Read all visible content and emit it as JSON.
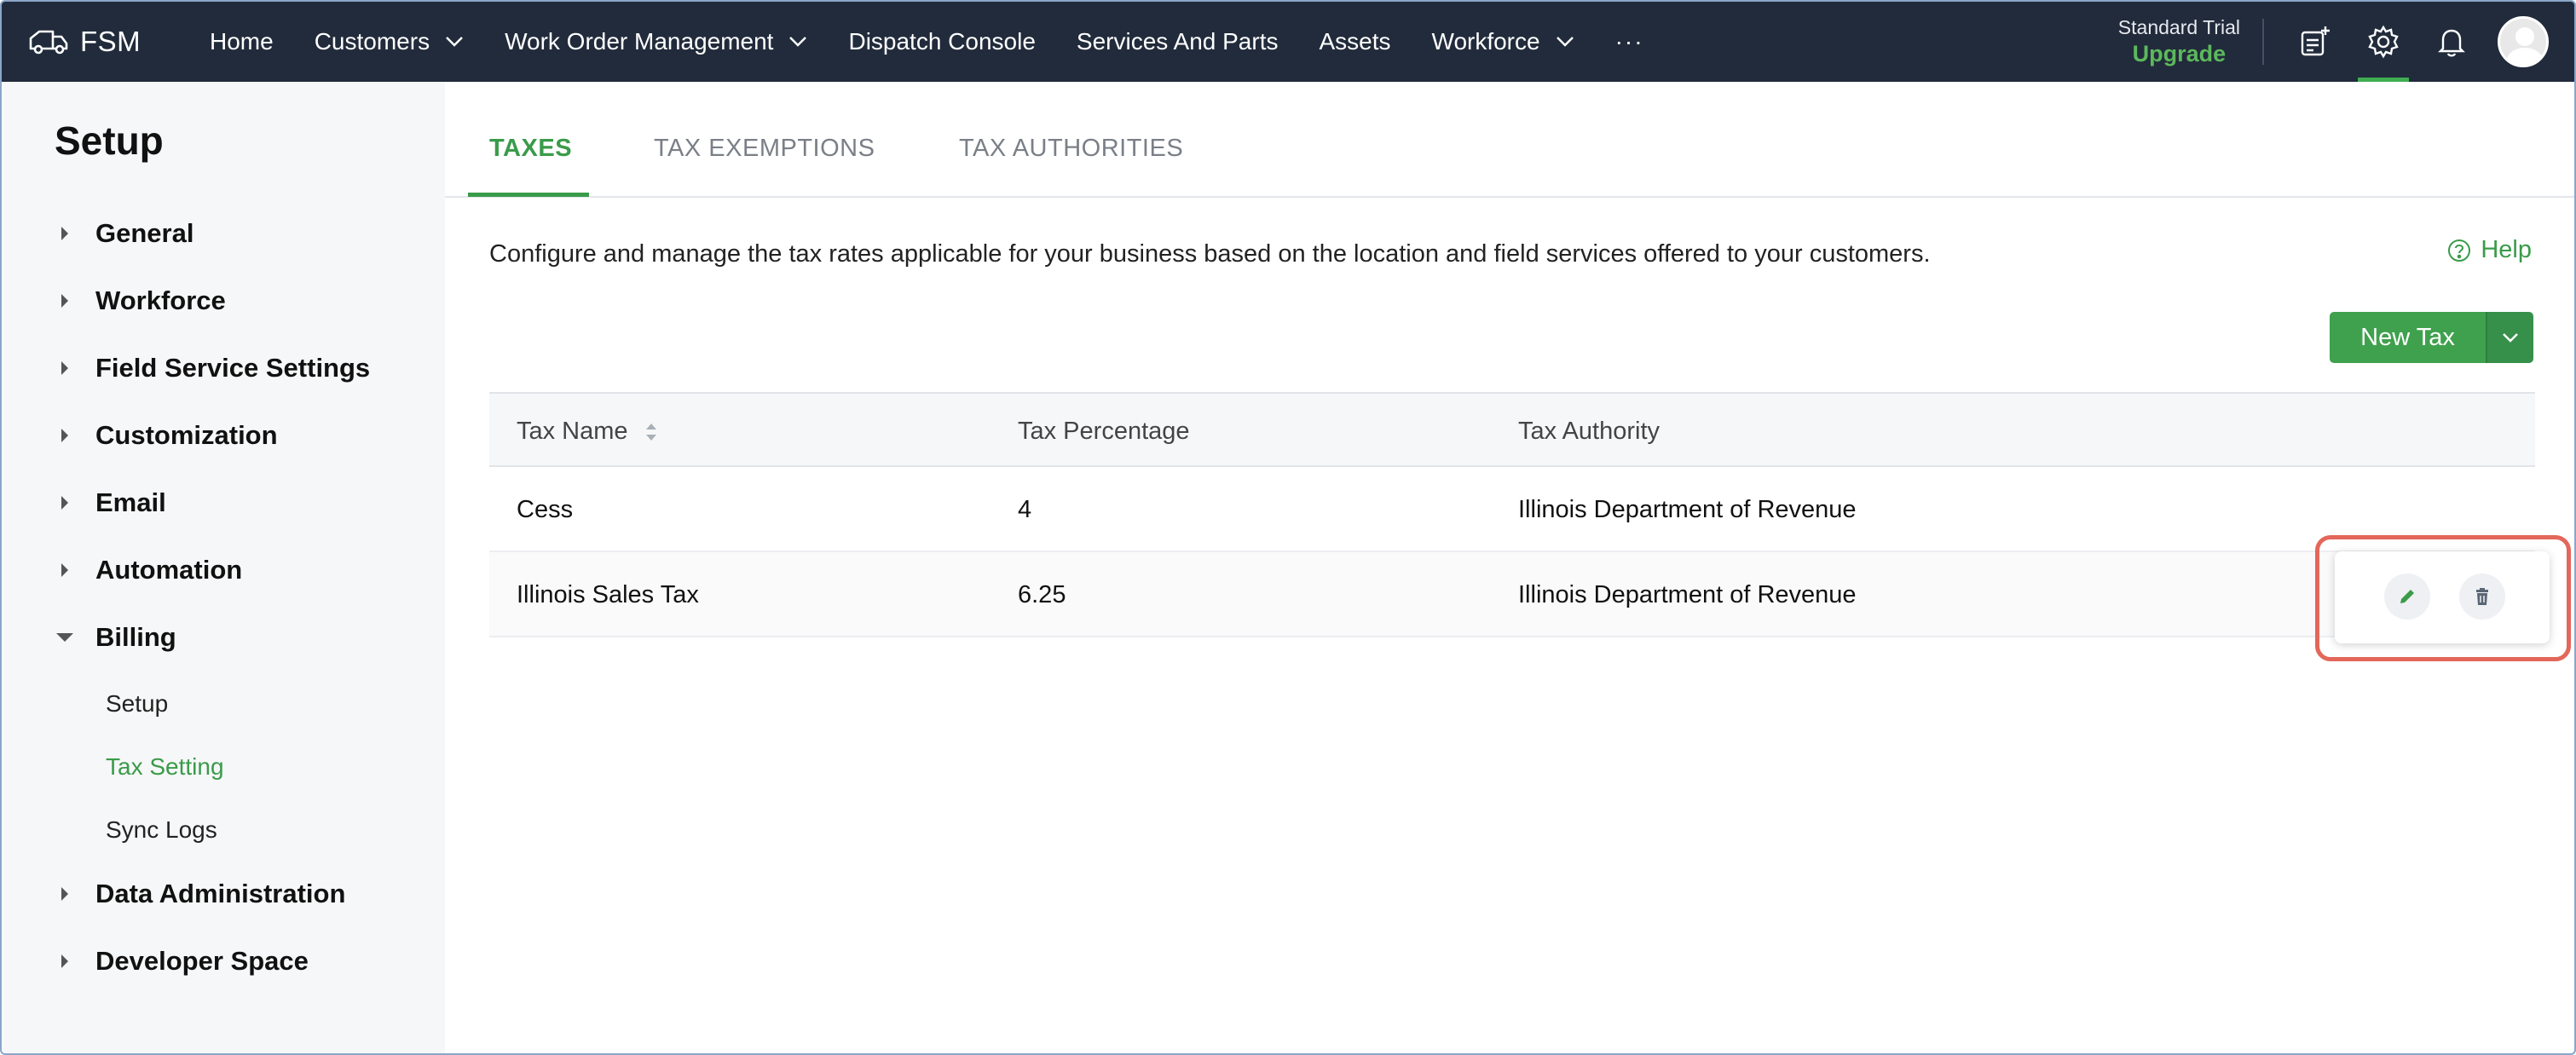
{
  "app": {
    "brand": "FSM"
  },
  "nav": {
    "items": [
      {
        "label": "Home"
      },
      {
        "label": "Customers"
      },
      {
        "label": "Work Order Management"
      },
      {
        "label": "Dispatch Console"
      },
      {
        "label": "Services And Parts"
      },
      {
        "label": "Assets"
      },
      {
        "label": "Workforce"
      }
    ],
    "more": "···"
  },
  "account": {
    "plan_label": "Standard Trial",
    "upgrade_label": "Upgrade"
  },
  "sidebar": {
    "title": "Setup",
    "sections": [
      {
        "label": "General"
      },
      {
        "label": "Workforce"
      },
      {
        "label": "Field Service Settings"
      },
      {
        "label": "Customization"
      },
      {
        "label": "Email"
      },
      {
        "label": "Automation"
      },
      {
        "label": "Billing"
      },
      {
        "label": "Data Administration"
      },
      {
        "label": "Developer Space"
      }
    ],
    "billing_sub": [
      {
        "label": "Setup"
      },
      {
        "label": "Tax Setting"
      },
      {
        "label": "Sync Logs"
      }
    ]
  },
  "tabs": [
    {
      "label": "TAXES"
    },
    {
      "label": "TAX EXEMPTIONS"
    },
    {
      "label": "TAX AUTHORITIES"
    }
  ],
  "main": {
    "description": "Configure and manage the tax rates applicable for your business based on the location and field services offered to your customers.",
    "help_label": "Help",
    "new_button": "New Tax"
  },
  "table": {
    "headers": [
      "Tax Name",
      "Tax Percentage",
      "Tax Authority"
    ],
    "rows": [
      {
        "name": "Cess",
        "percentage": "4",
        "authority": "Illinois Department of Revenue"
      },
      {
        "name": "Illinois Sales Tax",
        "percentage": "6.25",
        "authority": "Illinois Department of Revenue"
      }
    ]
  },
  "colors": {
    "topbar": "#212b3b",
    "accent": "#3a9b4a",
    "highlight": "#e3675a"
  },
  "icons": {
    "brand": "truck-icon",
    "notes": "add-note-icon",
    "settings": "gear-icon",
    "notifications": "bell-icon",
    "edit": "pencil-icon",
    "delete": "trash-icon",
    "help": "help-circle-icon"
  }
}
